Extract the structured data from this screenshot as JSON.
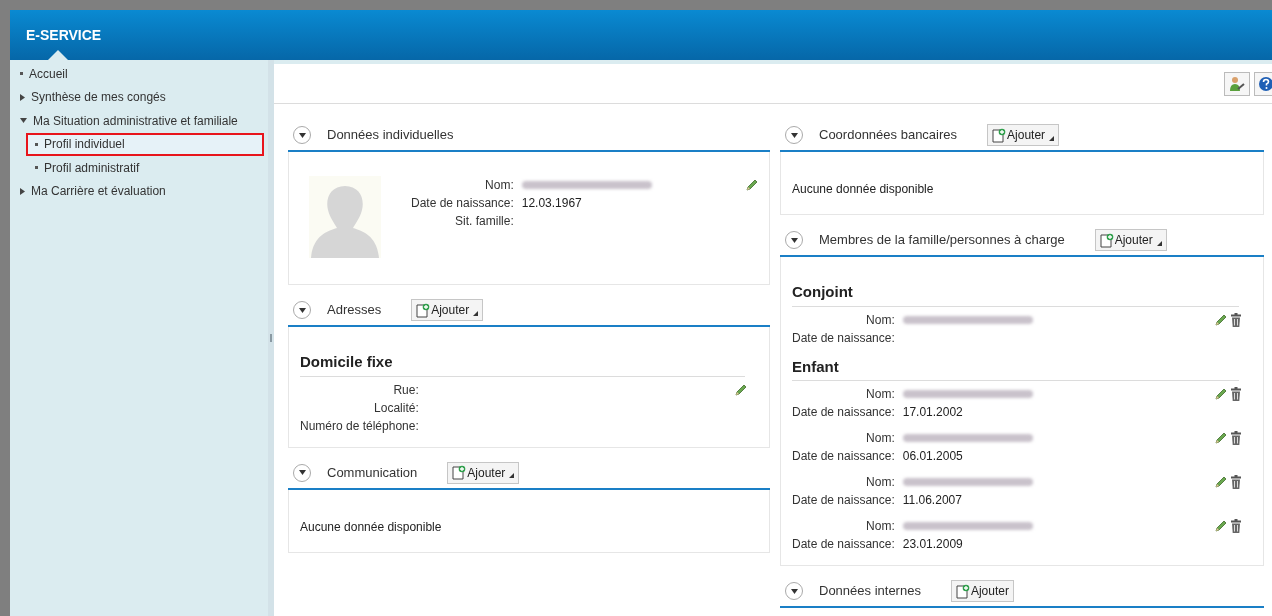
{
  "app": {
    "title": "E-SERVICE"
  },
  "sidebar": {
    "items": [
      {
        "label": "Accueil",
        "kind": "leaf",
        "selected": false
      },
      {
        "label": "Synthèse de mes congés",
        "kind": "folder",
        "expanded": false
      },
      {
        "label": "Ma Situation administrative et familiale",
        "kind": "folder",
        "expanded": true,
        "children": [
          {
            "label": "Profil individuel",
            "kind": "leaf",
            "selected": true
          },
          {
            "label": "Profil administratif",
            "kind": "leaf",
            "selected": false
          }
        ]
      },
      {
        "label": "Ma Carrière et évaluation",
        "kind": "folder",
        "expanded": false
      }
    ]
  },
  "columns": [
    [
      {
        "kind": "profile",
        "title": "Données individuelles",
        "expanded": true,
        "editable": true,
        "fields": [
          {
            "label": "Nom:",
            "redacted": true
          },
          {
            "label": "Date de naissance:",
            "value": "12.03.1967"
          },
          {
            "label": "Sit. famille:"
          }
        ]
      },
      {
        "kind": "groups",
        "title": "Adresses",
        "expanded": true,
        "add_button": {
          "label": "Ajouter",
          "menu": true
        },
        "groups": [
          {
            "heading": "Domicile fixe",
            "records": [
              {
                "editable": true,
                "deletable": false,
                "fields": [
                  {
                    "label": "Rue:"
                  },
                  {
                    "label": "Localité:"
                  },
                  {
                    "label": "Numéro de téléphone:"
                  }
                ]
              }
            ]
          }
        ]
      },
      {
        "kind": "empty",
        "title": "Communication",
        "expanded": true,
        "add_button": {
          "label": "Ajouter",
          "menu": true
        },
        "message": "Aucune donnée disponible"
      }
    ],
    [
      {
        "kind": "empty",
        "title": "Coordonnées bancaires",
        "expanded": true,
        "add_button": {
          "label": "Ajouter",
          "menu": true
        },
        "message": "Aucune donnée disponible"
      },
      {
        "kind": "groups",
        "title": "Membres de la famille/personnes à charge",
        "expanded": true,
        "add_button": {
          "label": "Ajouter",
          "menu": true
        },
        "groups": [
          {
            "heading": "Conjoint",
            "records": [
              {
                "editable": true,
                "deletable": true,
                "fields": [
                  {
                    "label": "Nom:",
                    "redacted": true
                  },
                  {
                    "label": "Date de naissance:"
                  }
                ]
              }
            ]
          },
          {
            "heading": "Enfant",
            "records": [
              {
                "editable": true,
                "deletable": true,
                "fields": [
                  {
                    "label": "Nom:",
                    "redacted": true
                  },
                  {
                    "label": "Date de naissance:",
                    "value": "17.01.2002"
                  }
                ]
              },
              {
                "editable": true,
                "deletable": true,
                "fields": [
                  {
                    "label": "Nom:",
                    "redacted": true
                  },
                  {
                    "label": "Date de naissance:",
                    "value": "06.01.2005"
                  }
                ]
              },
              {
                "editable": true,
                "deletable": true,
                "fields": [
                  {
                    "label": "Nom:",
                    "redacted": true
                  },
                  {
                    "label": "Date de naissance:",
                    "value": "11.06.2007"
                  }
                ]
              },
              {
                "editable": true,
                "deletable": true,
                "fields": [
                  {
                    "label": "Nom:",
                    "redacted": true
                  },
                  {
                    "label": "Date de naissance:",
                    "value": "23.01.2009"
                  }
                ]
              }
            ]
          }
        ]
      },
      {
        "kind": "header_only",
        "title": "Données internes",
        "expanded": true,
        "add_button": {
          "label": "Ajouter",
          "menu": false
        }
      }
    ]
  ]
}
